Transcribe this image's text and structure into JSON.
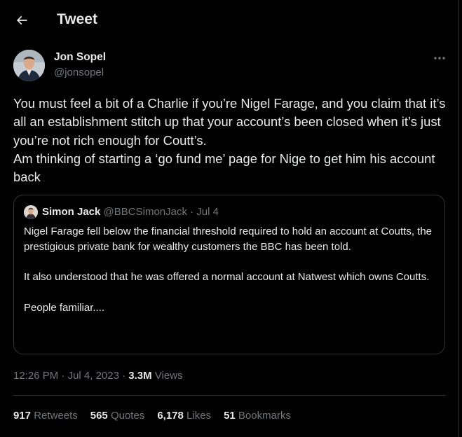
{
  "header": {
    "title": "Tweet",
    "back_icon": "arrow-left-icon"
  },
  "author": {
    "name": "Jon Sopel",
    "handle": "@jonsopel"
  },
  "more_icon": "more-horizontal-icon",
  "tweet": {
    "text": "You must feel a bit of a Charlie if you’re Nigel Farage, and you claim that it’s all an establishment stitch up that your account’s been closed when it’s just you’re not rich enough for Coutt’s.\nAm thinking of starting a ‘go fund me’ page for Nige to get him his account back"
  },
  "quote": {
    "name": "Simon Jack",
    "meta": "@BBCSimonJack · Jul 4",
    "text": "Nigel Farage fell below the financial threshold required to hold an account at Coutts, the prestigious private bank for wealthy customers the BBC has been told.\n\nIt also understood that he was offered a normal account at Natwest which owns Coutts.\n\nPeople familiar...."
  },
  "meta": {
    "time": "12:26 PM",
    "date": "Jul 4, 2023",
    "views_count": "3.3M",
    "views_label": "Views"
  },
  "stats": [
    {
      "count": "917",
      "label": "Retweets"
    },
    {
      "count": "565",
      "label": "Quotes"
    },
    {
      "count": "6,178",
      "label": "Likes"
    },
    {
      "count": "51",
      "label": "Bookmarks"
    }
  ],
  "colors": {
    "background": "#000000",
    "text": "#e7e9ea",
    "muted": "#71767b",
    "border": "#2f3336"
  }
}
